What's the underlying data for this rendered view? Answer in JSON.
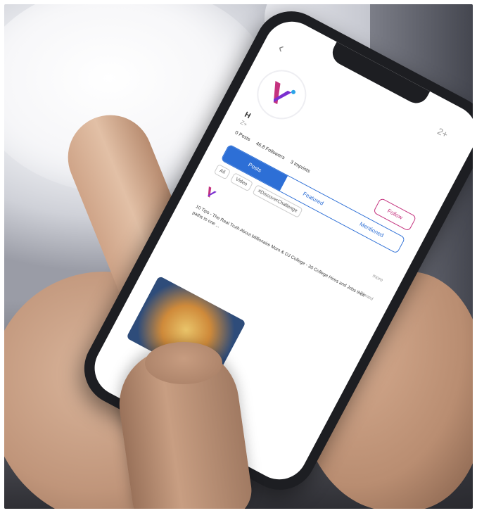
{
  "scene": {
    "description_free": true
  },
  "phone_screen": {
    "back_symbol": "‹",
    "top_right_symbol": "2+",
    "profile": {
      "name": "H",
      "handle": "Z+",
      "stats": [
        "0 Posts",
        "46.8 Followers",
        "3 Imprints"
      ],
      "follow_label": "Follow"
    },
    "tabs": [
      {
        "label": "Posts",
        "active": true
      },
      {
        "label": "Featured",
        "active": false
      },
      {
        "label": "Mentioned",
        "active": false
      }
    ],
    "chips": [
      "All",
      "Video",
      "#DiscoverChallenge"
    ],
    "post": {
      "author": "",
      "meta": "",
      "more": "more",
      "text": "10 Tips - The Real Truth About Millionaire Mom & DJ College - 30 College Hires and Jobs their paths to one ...",
      "pinned": "Pinned"
    },
    "colors": {
      "accent_blue": "#2d6fd6",
      "accent_magenta": "#c4327e",
      "logo_purple": "#7b2fd0",
      "logo_blue": "#2aa3e8"
    }
  }
}
